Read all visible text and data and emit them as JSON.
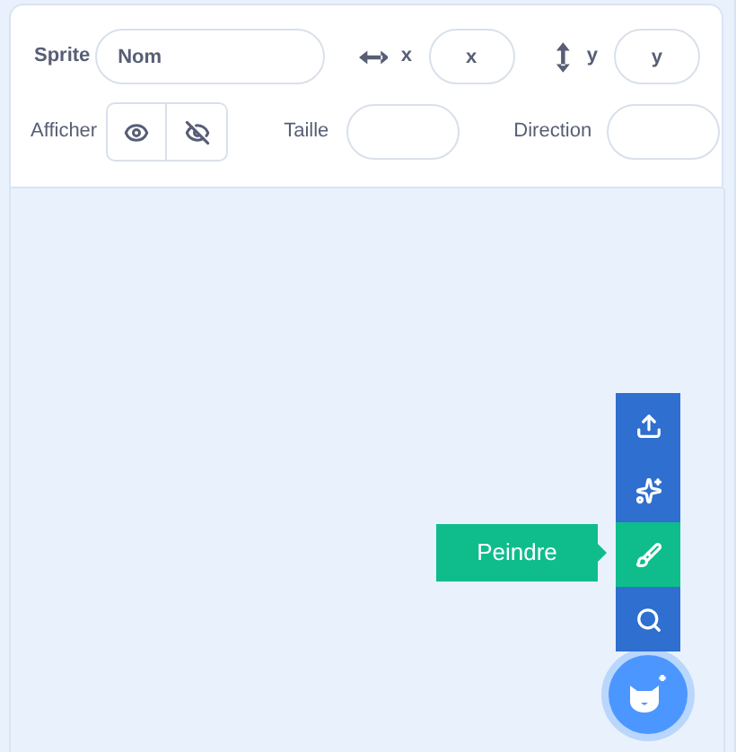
{
  "sprite_info": {
    "sprite": {
      "label": "Sprite",
      "placeholder": "Nom"
    },
    "x": {
      "label": "x",
      "placeholder": "x"
    },
    "y": {
      "label": "y",
      "placeholder": "y"
    },
    "show": {
      "label": "Afficher",
      "options": [
        {
          "kind": "visible",
          "selected": false
        },
        {
          "kind": "hidden",
          "selected": false
        }
      ]
    },
    "size": {
      "label": "Taille"
    },
    "direction": {
      "label": "Direction"
    }
  },
  "sprite_menu": {
    "items": [
      {
        "kind": "upload",
        "selected": false
      },
      {
        "kind": "surprise",
        "selected": false
      },
      {
        "kind": "paint",
        "selected": true
      },
      {
        "kind": "search",
        "selected": false
      }
    ],
    "tooltip": "Peindre"
  }
}
